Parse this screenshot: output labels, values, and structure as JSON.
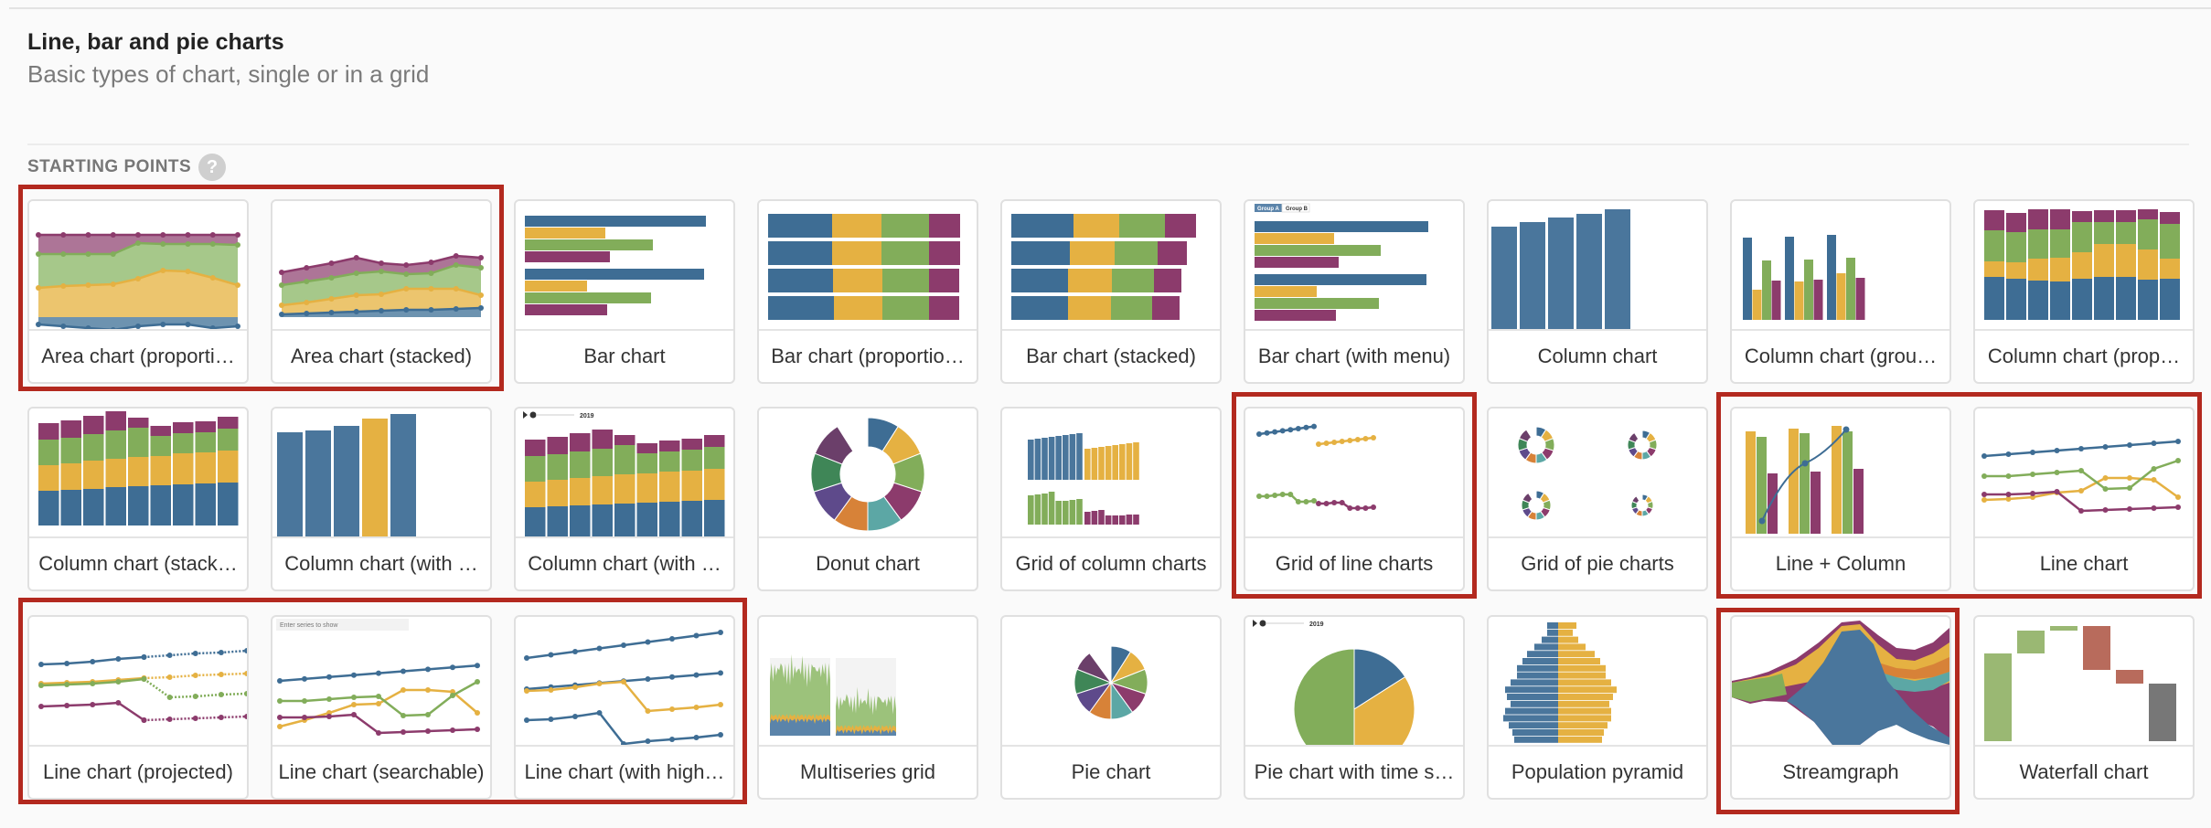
{
  "header": {
    "title": "Line, bar and pie charts",
    "subtitle": "Basic types of chart, single or in a grid"
  },
  "section": {
    "label": "STARTING POINTS",
    "help_icon": "?"
  },
  "colors": {
    "blue": "#3e6d94",
    "yellow": "#e5b142",
    "green": "#82ad5a",
    "purple": "#8c3b6c",
    "violet": "#5e4a8b",
    "darkgreen": "#3f8657",
    "orange": "#d78238",
    "teal": "#5ca7a5",
    "plum": "#6b3f6a",
    "highlight": "#b3291f",
    "red": "#b86b5c",
    "grey": "#777777"
  },
  "cards": [
    {
      "label": "Area chart (proporti…",
      "thumb": "area-prop",
      "highlighted": true
    },
    {
      "label": "Area chart (stacked)",
      "thumb": "area-stacked",
      "highlighted": true
    },
    {
      "label": "Bar chart",
      "thumb": "bar",
      "highlighted": false
    },
    {
      "label": "Bar chart (proportio…",
      "thumb": "bar-prop",
      "highlighted": false
    },
    {
      "label": "Bar chart (stacked)",
      "thumb": "bar-stacked",
      "highlighted": false
    },
    {
      "label": "Bar chart (with menu)",
      "thumb": "bar-menu",
      "highlighted": false,
      "menu": [
        "Group A",
        "Group B"
      ]
    },
    {
      "label": "Column chart",
      "thumb": "column",
      "highlighted": false
    },
    {
      "label": "Column chart (grou…",
      "thumb": "column-grouped",
      "highlighted": false
    },
    {
      "label": "Column chart (prop…",
      "thumb": "column-prop",
      "highlighted": false
    },
    {
      "label": "Column chart (stack…",
      "thumb": "column-stacked",
      "highlighted": false
    },
    {
      "label": "Column chart (with …",
      "thumb": "column-highlight",
      "highlighted": false
    },
    {
      "label": "Column chart (with …",
      "thumb": "column-timeslider",
      "highlighted": false,
      "slider_year": "2019"
    },
    {
      "label": "Donut chart",
      "thumb": "donut",
      "highlighted": false
    },
    {
      "label": "Grid of column charts",
      "thumb": "grid-columns",
      "highlighted": false
    },
    {
      "label": "Grid of line charts",
      "thumb": "grid-lines",
      "highlighted": true
    },
    {
      "label": "Grid of pie charts",
      "thumb": "grid-pies",
      "highlighted": false
    },
    {
      "label": "Line + Column",
      "thumb": "line-column",
      "highlighted": true
    },
    {
      "label": "Line chart",
      "thumb": "line",
      "highlighted": true
    },
    {
      "label": "Line chart (projected)",
      "thumb": "line-projected",
      "highlighted": true
    },
    {
      "label": "Line chart (searchable)",
      "thumb": "line-searchable",
      "highlighted": true,
      "search_placeholder": "Enter series to show"
    },
    {
      "label": "Line chart (with high…",
      "thumb": "line-highlight",
      "highlighted": true
    },
    {
      "label": "Multiseries grid",
      "thumb": "multiseries",
      "highlighted": false
    },
    {
      "label": "Pie chart",
      "thumb": "pie",
      "highlighted": false
    },
    {
      "label": "Pie chart with time s…",
      "thumb": "pie-timeslider",
      "highlighted": false,
      "slider_year": "2019"
    },
    {
      "label": "Population pyramid",
      "thumb": "pyramid",
      "highlighted": false
    },
    {
      "label": "Streamgraph",
      "thumb": "streamgraph",
      "highlighted": true
    },
    {
      "label": "Waterfall chart",
      "thumb": "waterfall",
      "highlighted": false
    }
  ]
}
